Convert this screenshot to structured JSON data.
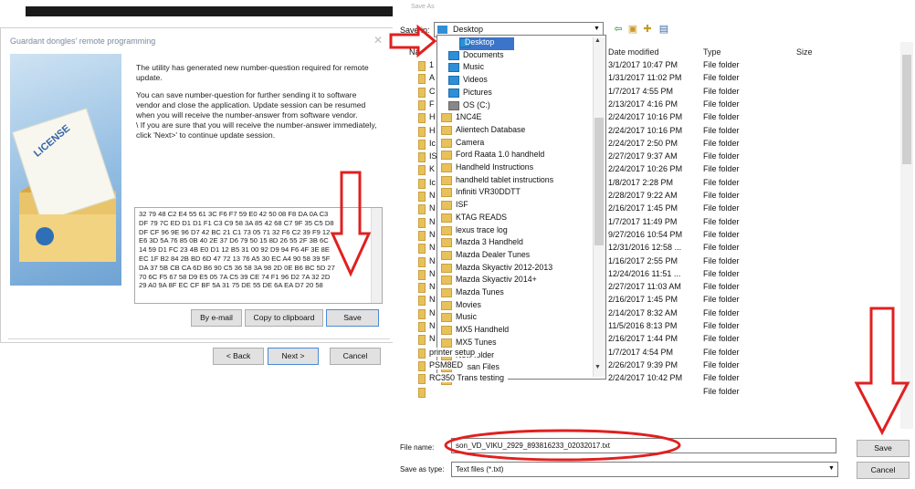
{
  "wizard": {
    "title": "Guardant dongles' remote programming",
    "close": "✕",
    "license_text": "LICENSE",
    "msg1": "The utility has generated new number-question required for remote update.",
    "msg2": "You can save number-question for further sending it to software vendor and close the application. Update session can be resumed when you will receive the number-answer from software vendor.",
    "msg3": "\\ If you are sure that you will receive the number-answer immediately, click 'Next>' to continue update session.",
    "hex_lines": [
      "32 79 48 C2 E4 55 61 3C F6 F7 59 E0 42 50 08 F8 DA 0A C3",
      "DF 79 7C ED D1 D1 F1 C3 C9 58 3A 85 42 68 C7 9F 35 C5 D8",
      "DF CF 96 9E 96 D7 42 BC 21 C1 73 05 71 32 F6 C2 39 F9 12",
      "E6 3D 5A 76 85 0B 40 2E 37 D6 79 50 15 8D 26 55 2F 3B 6C",
      "14 59 D1 FC 23 4B E0 D1 12 B5 31 00 92 D9 94 F6 4F 3E 8E",
      "EC 1F B2 84 2B BD 6D 47 72 13 76 A5 30 EC A4 90 58 39 5F",
      "DA 37 5B CB CA 6D B6 90 C5 36 58 3A 98 2D 0E B6 BC 5D 27",
      "70 6C F5 67 58 D9 E5 05 7A C5 39 CE 74 F1 96 D2 7A 32 2D",
      "29 A0 9A 8F EC CF BF 5A 31 75 DE 55 DE 6A EA D7 20 58"
    ],
    "btn_email": "By e-mail",
    "btn_clipboard": "Copy to clipboard",
    "btn_save": "Save",
    "btn_back": "< Back",
    "btn_next": "Next >",
    "btn_cancel": "Cancel"
  },
  "save_dialog": {
    "title": "Save As",
    "save_in_label": "Save in:",
    "save_in_value": "Desktop",
    "left_col_label": "Na",
    "col_date": "Date modified",
    "col_type": "Type",
    "col_size": "Size",
    "left_letters": [
      "1",
      "A",
      "C",
      "F",
      "H",
      "H",
      "Ic",
      "IS",
      "K",
      "Ic",
      "N",
      "N",
      "N",
      "N",
      "N",
      "N",
      "N",
      "N",
      "N",
      "N",
      "N",
      "N",
      "N",
      "N"
    ],
    "rows": [
      {
        "date": "3/1/2017 10:47 PM",
        "type": "File folder"
      },
      {
        "date": "1/31/2017 11:02 PM",
        "type": "File folder"
      },
      {
        "date": "1/7/2017 4:55 PM",
        "type": "File folder"
      },
      {
        "date": "2/13/2017 4:16 PM",
        "type": "File folder"
      },
      {
        "date": "2/24/2017 10:16 PM",
        "type": "File folder"
      },
      {
        "date": "2/24/2017 10:16 PM",
        "type": "File folder"
      },
      {
        "date": "2/24/2017 2:50 PM",
        "type": "File folder"
      },
      {
        "date": "2/27/2017 9:37 AM",
        "type": "File folder"
      },
      {
        "date": "2/24/2017 10:26 PM",
        "type": "File folder"
      },
      {
        "date": "1/8/2017 2:28 PM",
        "type": "File folder"
      },
      {
        "date": "2/28/2017 9:22 AM",
        "type": "File folder"
      },
      {
        "date": "2/16/2017 1:45 PM",
        "type": "File folder"
      },
      {
        "date": "1/7/2017 11:49 PM",
        "type": "File folder"
      },
      {
        "date": "9/27/2016 10:54 PM",
        "type": "File folder"
      },
      {
        "date": "12/31/2016 12:58 ...",
        "type": "File folder"
      },
      {
        "date": "1/16/2017 2:55 PM",
        "type": "File folder"
      },
      {
        "date": "12/24/2016 11:51 ...",
        "type": "File folder"
      },
      {
        "date": "2/27/2017 11:03 AM",
        "type": "File folder"
      },
      {
        "date": "2/16/2017 1:45 PM",
        "type": "File folder"
      },
      {
        "date": "2/14/2017 8:32 AM",
        "type": "File folder"
      },
      {
        "date": "11/5/2016 8:13 PM",
        "type": "File folder"
      },
      {
        "date": "2/16/2017 1:44 PM",
        "type": "File folder"
      },
      {
        "date": "1/7/2017 4:54 PM",
        "type": "File folder"
      },
      {
        "date": "2/26/2017 9:39 PM",
        "type": "File folder"
      },
      {
        "date": "2/24/2017 10:42 PM",
        "type": "File folder"
      },
      {
        "date": "",
        "type": "File folder"
      }
    ],
    "below_names": [
      "printer setup",
      "PSM8ED",
      "RC350 Trans testing"
    ],
    "dropdown": {
      "selected": "Desktop",
      "sub": [
        "Documents",
        "Music",
        "Videos",
        "Pictures",
        "OS (C:)"
      ],
      "folders": [
        "1NC4E",
        "Alientech Database",
        "Camera",
        "Ford Raata 1.0 handheld",
        "Handheld Instructions",
        "handheld tablet instructions",
        "Infiniti VR30DDTT",
        "ISF",
        "KTAG READS",
        "lexus trace log",
        "Mazda 3 Handheld",
        "Mazda Dealer Tunes",
        "Mazda Skyactiv 2012-2013",
        "Mazda Skyactiv 2014+",
        "Mazda Tunes",
        "Movies",
        "Music",
        "MX5 Handheld",
        "MX5 Tunes",
        "New folder",
        "Nissan Files",
        "Nissan Tunes"
      ]
    },
    "file_name_label": "File name:",
    "file_name_value": "son_VD_VIKU_2929_893816233_02032017.txt",
    "save_type_label": "Save as type:",
    "save_type_value": "Text files (*.txt)",
    "btn_save": "Save",
    "btn_cancel": "Cancel"
  },
  "annotation_color": "#e02020"
}
